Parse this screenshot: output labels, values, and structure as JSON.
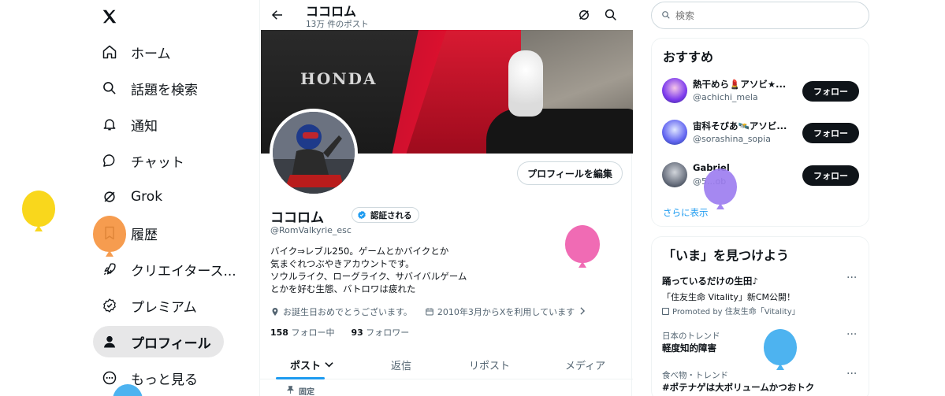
{
  "nav": {
    "items": [
      {
        "label": "ホーム"
      },
      {
        "label": "話題を検索"
      },
      {
        "label": "通知"
      },
      {
        "label": "チャット"
      },
      {
        "label": "Grok"
      },
      {
        "label": "履歴"
      },
      {
        "label": "クリエイタース..."
      },
      {
        "label": "プレミアム"
      },
      {
        "label": "プロフィール"
      },
      {
        "label": "もっと見る"
      }
    ]
  },
  "header": {
    "title": "ココロム",
    "subtitle": "13万 件のポスト"
  },
  "profile": {
    "edit_label": "プロフィールを編集",
    "name": "ココロム",
    "verify_label": "認証される",
    "handle": "@RomValkyrie_esc",
    "bio": [
      "バイク⇒レブル250。ゲームとかバイクとか",
      "気まぐれつぶやきアカウントです。",
      "ソウルライク、ローグライク、サバイバルゲーム",
      "とかを好む生態、バトロワは疲れた"
    ],
    "birthday": "お誕生日おめでとうございます。",
    "joined": "2010年3月からXを利用しています",
    "following_count": "158",
    "following_label": "フォロー中",
    "followers_count": "93",
    "followers_label": "フォロワー",
    "banner_text": "HONDA"
  },
  "tabs": [
    {
      "label": "ポスト"
    },
    {
      "label": "返信"
    },
    {
      "label": "リポスト"
    },
    {
      "label": "メディア"
    }
  ],
  "pinned_label": "固定",
  "search": {
    "placeholder": "検索"
  },
  "recommend": {
    "title": "おすすめ",
    "follow_label": "フォロー",
    "users": [
      {
        "name": "熱干めら💄アソビ★...",
        "handle": "@achichi_mela"
      },
      {
        "name": "宙科そびあ🛰️アソビ...",
        "handle": "@sorashina_sopia"
      },
      {
        "name": "Gabriel",
        "handle": "@5...ob"
      }
    ],
    "more": "さらに表示"
  },
  "trends": {
    "title": "「いま」を見つけよう",
    "items": [
      {
        "headline": "踊っているだけの生田♪",
        "desc": "「住友生命 Vitality」新CM公開！",
        "promo": "Promoted by 住友生命「Vitality」"
      },
      {
        "category": "日本のトレンド",
        "headline": "軽度知的障害"
      },
      {
        "category": "食べ物・トレンド",
        "headline": "#ポテナゲは大ボリュームかつおトク"
      }
    ]
  },
  "colors": {
    "accent": "#1d9bf0",
    "text": "#0f1419",
    "muted": "#536471"
  }
}
